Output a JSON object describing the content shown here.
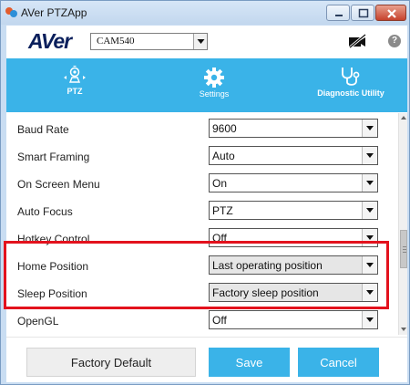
{
  "window": {
    "title": "AVer PTZApp"
  },
  "header": {
    "logo": "AVer",
    "camera_select": {
      "value": "CAM540"
    }
  },
  "tabs": [
    {
      "label": "PTZ",
      "icon": "camera-ptz-icon"
    },
    {
      "label": "Settings",
      "icon": "gear-icon",
      "active": true
    },
    {
      "label": "Diagnostic Utility",
      "icon": "stethoscope-icon"
    }
  ],
  "settings": [
    {
      "label": "Baud Rate",
      "value": "9600"
    },
    {
      "label": "Smart Framing",
      "value": "Auto"
    },
    {
      "label": "On Screen Menu",
      "value": "On"
    },
    {
      "label": "Auto Focus",
      "value": "PTZ"
    },
    {
      "label": "Hotkey Control",
      "value": "Off"
    },
    {
      "label": "Home Position",
      "value": "Last operating position"
    },
    {
      "label": "Sleep Position",
      "value": "Factory sleep position"
    },
    {
      "label": "OpenGL",
      "value": "Off"
    }
  ],
  "footer": {
    "factory_default": "Factory Default",
    "save": "Save",
    "cancel": "Cancel"
  },
  "colors": {
    "accent": "#3ab3e8",
    "highlight": "#e3121d"
  }
}
